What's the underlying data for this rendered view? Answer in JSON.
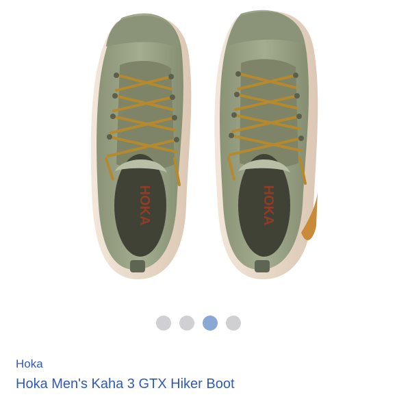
{
  "product": {
    "brand": "Hoka",
    "title": "Hoka Men's Kaha 3 GTX Hiker Boot",
    "image_alt": "Top-down view of a pair of olive green hiking boots with mustard laces and HOKA logo on the tongue lining",
    "logo_text": "HOKA"
  },
  "carousel": {
    "total": 4,
    "active_index": 2,
    "active_color": "#8aa8d6",
    "inactive_color": "#d0d0d3"
  },
  "colors": {
    "link": "#2f58b8",
    "boot_upper": "#9aa485",
    "boot_dark": "#6d7461",
    "sole": "#e8d9c8",
    "laces": "#b5892e"
  }
}
